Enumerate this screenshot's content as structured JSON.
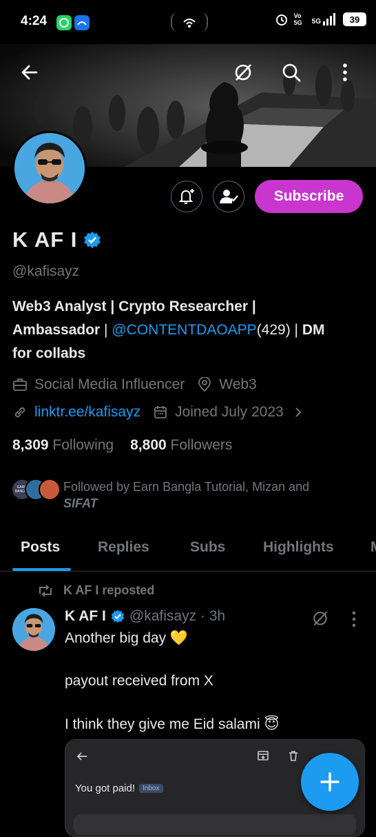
{
  "status_bar": {
    "time": "4:24",
    "network": "Vo 5G",
    "signal_label": "5G",
    "battery": "39"
  },
  "profile": {
    "name": "K AF I",
    "handle": "@kafisayz",
    "bio_part1": "Web3 Analyst | Crypto Researcher |",
    "bio_part2_a": "Ambassador",
    "bio_part2_sep": " | ",
    "bio_mention": "@CONTENTDAOAPP",
    "bio_mention_count": "(429) | ",
    "bio_part2_b": "DM",
    "bio_part3": "for collabs",
    "category": "Social Media Influencer",
    "location": "Web3",
    "website": "linktr.ee/kafisayz",
    "joined": "Joined July 2023",
    "following_count": "8,309",
    "following_label": "Following",
    "followers_count": "8,800",
    "followers_label": "Followers",
    "followed_by_line1": "Followed by Earn Bangla Tutorial, Mizan and",
    "followed_by_line2": "SIFAT",
    "mini_avatar_label": "EARN BANGLA"
  },
  "buttons": {
    "subscribe": "Subscribe"
  },
  "tabs": [
    {
      "label": "Posts"
    },
    {
      "label": "Replies"
    },
    {
      "label": "Subs"
    },
    {
      "label": "Highlights"
    },
    {
      "label": "M"
    }
  ],
  "post": {
    "reposted_by": "K AF I reposted",
    "author": "K AF I",
    "handle_time": "@kafisayz · 3h",
    "line1": "Another big day 💛",
    "line2": "payout received from X",
    "line3": "I think they give me Eid salami 😇",
    "media_text": "You got paid!",
    "media_tag": "Inbox"
  },
  "colors": {
    "accent": "#1d9bf0",
    "subscribe": "#c936cf",
    "muted": "#71767b"
  },
  "icons": [
    "back-arrow-icon",
    "grok-icon",
    "search-icon",
    "more-vertical-icon",
    "bell-plus-icon",
    "following-check-icon",
    "verified-badge-icon",
    "briefcase-icon",
    "location-pin-icon",
    "link-icon",
    "calendar-icon",
    "chevron-right-icon",
    "repost-icon",
    "plus-icon"
  ]
}
